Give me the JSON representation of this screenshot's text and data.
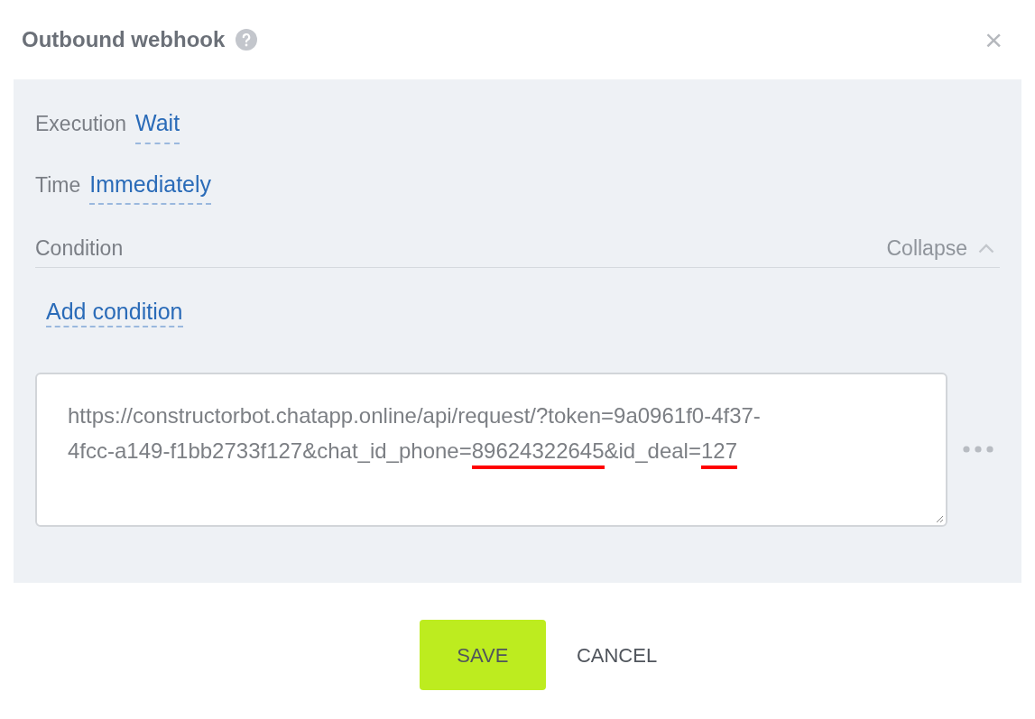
{
  "dialog": {
    "title": "Outbound webhook",
    "close": "×"
  },
  "fields": [
    {
      "label": "Execution",
      "value": "Wait"
    },
    {
      "label": "Time",
      "value": "Immediately"
    }
  ],
  "condition": {
    "label": "Condition",
    "toggle": "Collapse",
    "expanded": true,
    "add_link": "Add condition"
  },
  "url_field": {
    "segments": [
      {
        "text": "https://constructorbot.chatapp.online/api/request/?token=9a0961f0-4f37-4fcc-a149-f1bb2733f127&chat_id_phone=",
        "highlighted": false
      },
      {
        "text": "89624322645",
        "highlighted": true
      },
      {
        "text": "&id_deal=",
        "highlighted": false
      },
      {
        "text": "127",
        "highlighted": true
      }
    ]
  },
  "buttons": [
    {
      "label": "SAVE",
      "kind": "primary"
    },
    {
      "label": "CANCEL",
      "kind": "plain"
    }
  ]
}
